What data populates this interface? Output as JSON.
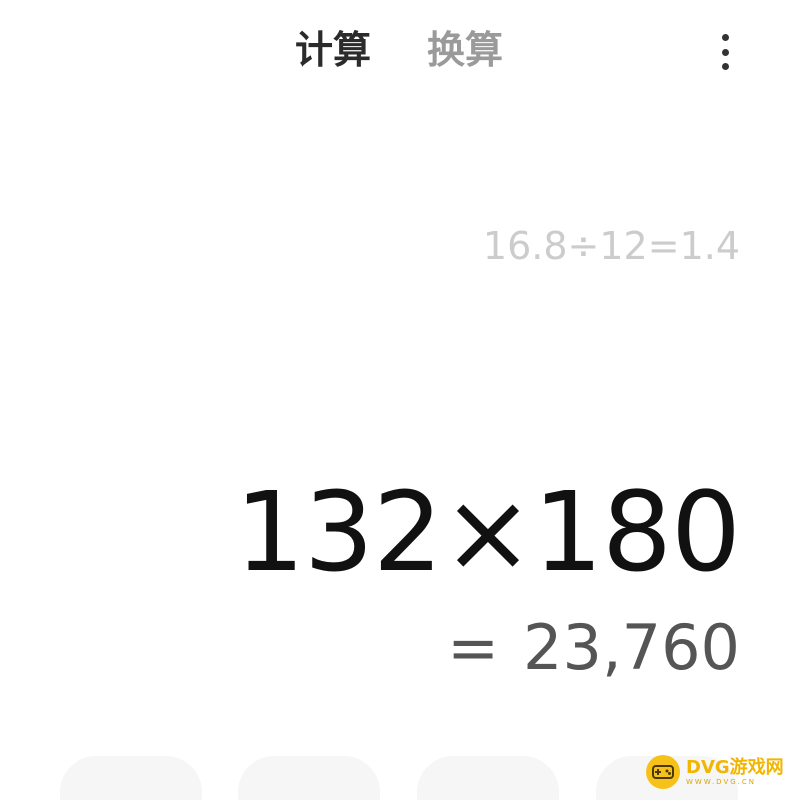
{
  "tabs": {
    "calculate": "计算",
    "convert": "换算"
  },
  "menu": {
    "icon": "more-vertical-icon"
  },
  "history": {
    "entry": "16.8÷12=1.4"
  },
  "display": {
    "expression": "132×180",
    "result_prefix": "=",
    "result": "23,760"
  },
  "watermark": {
    "title": "DVG游戏网",
    "subtitle": "WWW.DVG.CN",
    "icon": "gamepad-icon"
  },
  "colors": {
    "background": "#ffffff",
    "active_tab": "#2b2b2b",
    "inactive_tab": "#9a9a9a",
    "history_text": "#cccccc",
    "expression_text": "#111111",
    "result_text": "#555555",
    "key_background": "#f6f6f6",
    "watermark_yellow": "#f6c21a"
  }
}
